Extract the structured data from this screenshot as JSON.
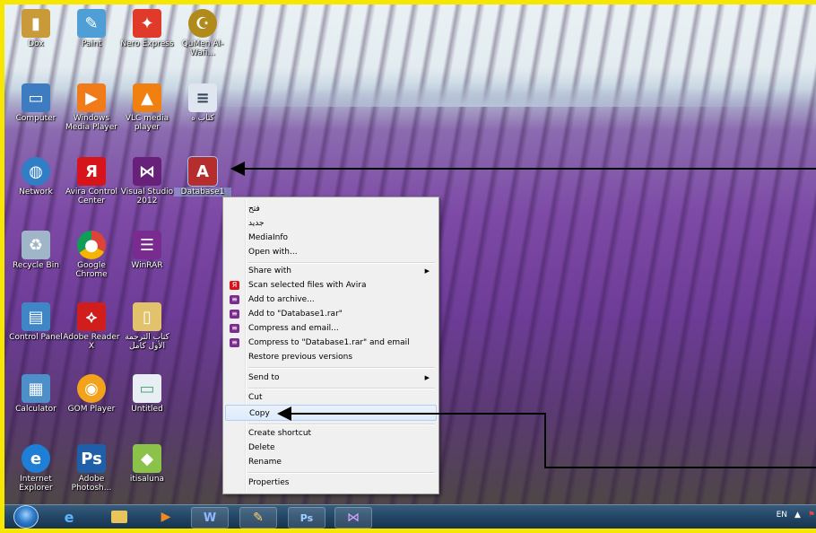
{
  "desktop": {
    "icons": [
      {
        "label": "Dox",
        "icon": "folder-user-icon",
        "color": "#c99a3a"
      },
      {
        "label": "Paint",
        "icon": "paint-icon",
        "color": "#4f9fd6"
      },
      {
        "label": "Nero Express",
        "icon": "nero-icon",
        "color": "#e03b2a"
      },
      {
        "label": "QuMen Al-Wafi...",
        "icon": "quran-app-icon",
        "color": "#b08a1a"
      },
      {
        "label": "Computer",
        "icon": "computer-icon",
        "color": "#3d7cc0"
      },
      {
        "label": "Windows Media Player",
        "icon": "media-player-icon",
        "color": "#f07b18"
      },
      {
        "label": "VLC media player",
        "icon": "vlc-icon",
        "color": "#f08010"
      },
      {
        "label": "كتاب ه",
        "icon": "document-icon",
        "color": "#dfe6ef"
      },
      {
        "label": "Network",
        "icon": "network-icon",
        "color": "#2f7ec6"
      },
      {
        "label": "Avira Control Center",
        "icon": "avira-icon",
        "color": "#d7141a"
      },
      {
        "label": "Visual Studio 2012",
        "icon": "visual-studio-icon",
        "color": "#68217a"
      },
      {
        "label": "Database1",
        "icon": "access-database-icon",
        "color": "#b52d2d"
      },
      {
        "label": "Recycle Bin",
        "icon": "recycle-bin-icon",
        "color": "#9fb6c8"
      },
      {
        "label": "Google Chrome",
        "icon": "chrome-icon",
        "color": "#db4437"
      },
      {
        "label": "WinRAR",
        "icon": "winrar-icon",
        "color": "#7a2b8f"
      },
      {
        "label": "Control Panel",
        "icon": "control-panel-icon",
        "color": "#3f86c7"
      },
      {
        "label": "Adobe Reader X",
        "icon": "adobe-reader-icon",
        "color": "#d21d1d"
      },
      {
        "label": "كتاب الترجمة الأول كامل",
        "icon": "folder-icon",
        "color": "#e2c26a"
      },
      {
        "label": "Calculator",
        "icon": "calculator-icon",
        "color": "#4c8fc9"
      },
      {
        "label": "GOM Player",
        "icon": "gom-player-icon",
        "color": "#f2a21b"
      },
      {
        "label": "Untitled",
        "icon": "image-file-icon",
        "color": "#e8eef4"
      },
      {
        "label": "Internet Explorer",
        "icon": "internet-explorer-icon",
        "color": "#1d7fd6"
      },
      {
        "label": "Adobe Photosh...",
        "icon": "photoshop-icon",
        "color": "#1f5ea8"
      },
      {
        "label": "itisaluna",
        "icon": "itisaluna-icon",
        "color": "#8bc34a"
      }
    ]
  },
  "context_menu": {
    "items": [
      {
        "label": "فتح",
        "icon": ""
      },
      {
        "label": "جديد",
        "icon": ""
      },
      {
        "label": "MediaInfo",
        "icon": ""
      },
      {
        "label": "Open with...",
        "icon": ""
      },
      {
        "label": "Share with",
        "icon": "",
        "submenu": true
      },
      {
        "label": "Scan selected files with Avira",
        "icon": "avira-small-icon"
      },
      {
        "label": "Add to archive...",
        "icon": "winrar-small-icon"
      },
      {
        "label": "Add to \"Database1.rar\"",
        "icon": "winrar-small-icon"
      },
      {
        "label": "Compress and email...",
        "icon": "winrar-small-icon"
      },
      {
        "label": "Compress to \"Database1.rar\" and email",
        "icon": "winrar-small-icon"
      },
      {
        "label": "Restore previous versions",
        "icon": ""
      },
      {
        "label": "Send to",
        "icon": "",
        "submenu": true
      },
      {
        "label": "Cut",
        "icon": ""
      },
      {
        "label": "Copy",
        "icon": "",
        "highlighted": true
      },
      {
        "label": "Create shortcut",
        "icon": ""
      },
      {
        "label": "Delete",
        "icon": ""
      },
      {
        "label": "Rename",
        "icon": ""
      },
      {
        "label": "Properties",
        "icon": ""
      }
    ]
  },
  "taskbar": {
    "apps": [
      "internet-explorer-icon",
      "explorer-folder-icon",
      "media-player-icon",
      "word-icon",
      "paint-icon",
      "photoshop-icon",
      "visual-studio-icon"
    ],
    "language": "EN",
    "tray_arrow": "▲"
  }
}
